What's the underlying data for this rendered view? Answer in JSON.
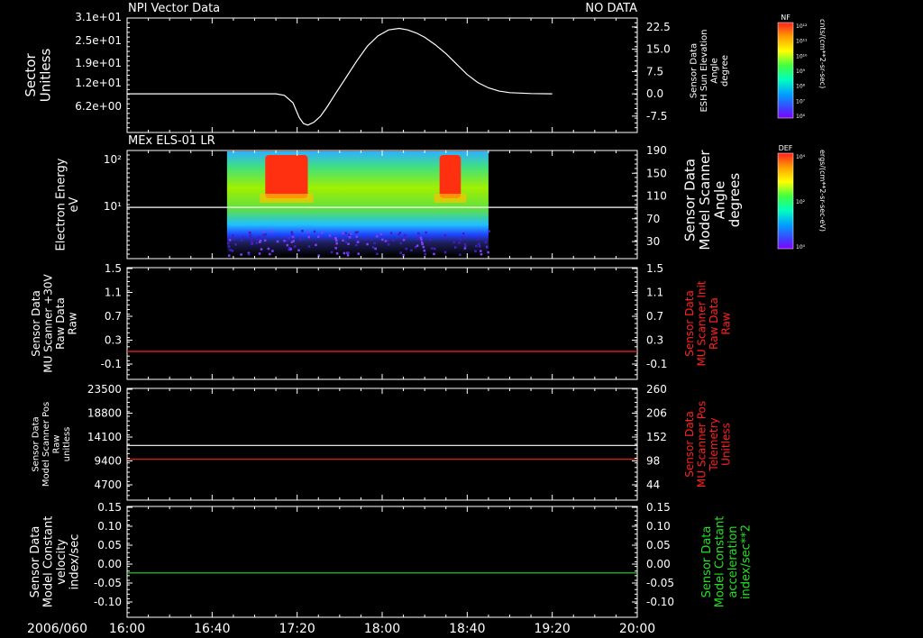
{
  "colors": {
    "white": "#ffffff",
    "red": "#ff2020",
    "green": "#20e020",
    "background": "#000000"
  },
  "time_axis": {
    "date_label": "2006/060",
    "ticks": [
      "16:00",
      "16:40",
      "17:20",
      "18:00",
      "18:40",
      "19:20",
      "20:00"
    ]
  },
  "colorbars": [
    {
      "label": "NF",
      "unit": "cnts/(cm**2-sr-sec)",
      "ticks": [
        "10¹²",
        "10¹¹",
        "10¹⁰",
        "10⁹",
        "10⁸",
        "10⁷",
        "10⁶"
      ]
    },
    {
      "label": "DEF",
      "unit": "ergs/(cm**2-sr-sec-eV)",
      "ticks": [
        "10⁴",
        "10²",
        "10⁰"
      ]
    }
  ],
  "chart_data": [
    {
      "type": "line",
      "panel": 1,
      "title": "NPI Vector Data",
      "status": "NO DATA",
      "ylabel_left": [
        "Sector",
        "Unitless"
      ],
      "yticks_left": [
        "3.1e+01",
        "2.5e+01",
        "1.9e+01",
        "1.2e+01",
        "6.2e+00"
      ],
      "ylabel_right": [
        "Sensor Data",
        "ESH Sun Elevation",
        "Angle",
        "degree"
      ],
      "yticks_right": [
        "22.5",
        "15.0",
        "7.5",
        "0.0",
        "-7.5"
      ],
      "ylim_right": [
        -13.0,
        25.5
      ],
      "series": [
        {
          "color": "white",
          "x": [
            "16:00",
            "17:10",
            "17:14",
            "17:18",
            "17:21",
            "17:23",
            "17:25",
            "17:28",
            "17:31",
            "17:34",
            "17:38",
            "17:43",
            "17:48",
            "17:53",
            "17:58",
            "18:03",
            "18:08",
            "18:12",
            "18:16",
            "18:20",
            "18:25",
            "18:30",
            "18:35",
            "18:40",
            "18:45",
            "18:50",
            "18:55",
            "19:00",
            "19:10",
            "19:20"
          ],
          "y": [
            0.0,
            0.0,
            -0.5,
            -3.0,
            -8.0,
            -10.0,
            -10.5,
            -9.5,
            -7.5,
            -4.5,
            0.0,
            5.5,
            11.0,
            16.0,
            19.5,
            21.5,
            22.0,
            21.5,
            20.5,
            19.0,
            16.5,
            13.5,
            10.0,
            6.5,
            3.8,
            2.0,
            0.9,
            0.4,
            0.1,
            0.0
          ]
        }
      ]
    },
    {
      "type": "heatmap",
      "panel": 2,
      "title": "MEx ELS-01 LR",
      "ylabel_left": [
        "Electron Energy",
        "eV"
      ],
      "yticks_left": [
        "10²",
        "10¹"
      ],
      "ylabel_right": [
        "Sensor Data",
        "Model Scanner",
        "Angle",
        "degrees"
      ],
      "yticks_right": [
        "190",
        "150",
        "110",
        "70",
        "30"
      ],
      "ylim_right": [
        0,
        190
      ],
      "data_span": [
        "16:47",
        "18:50"
      ],
      "intense_regions": [
        [
          "17:05",
          "17:25"
        ],
        [
          "18:27",
          "18:37"
        ]
      ],
      "series": [
        {
          "color": "white",
          "x": [
            "16:00",
            "20:00"
          ],
          "y": [
            90,
            90
          ]
        }
      ]
    },
    {
      "type": "line",
      "panel": 3,
      "ylabel_left": [
        "Sensor Data",
        "MU Scanner +30V",
        "Raw Data",
        "Raw"
      ],
      "yticks_left": [
        "1.5",
        "1.1",
        "0.7",
        "0.3",
        "-0.1"
      ],
      "ylabel_right": [
        "Sensor Data",
        "MU Scanner Init",
        "Raw Data",
        "Raw"
      ],
      "ylabel_right_color": "red",
      "yticks_right": [
        "1.5",
        "1.1",
        "0.7",
        "0.3",
        "-0.1"
      ],
      "ylim": [
        -0.5,
        1.5
      ],
      "series": [
        {
          "color": "red",
          "x": [
            "16:00",
            "20:00"
          ],
          "y": [
            0.0,
            0.0
          ]
        }
      ]
    },
    {
      "type": "line",
      "panel": 4,
      "ylabel_left": [
        "Sensor Data",
        "Model Scanner Pos",
        "Raw",
        "unitless"
      ],
      "yticks_left": [
        "23500",
        "18800",
        "14100",
        "9400",
        "4700"
      ],
      "ylabel_right": [
        "Sensor Data",
        "MU Scanner Pos",
        "Telemetry",
        "Unitless"
      ],
      "ylabel_right_color": "red",
      "yticks_right": [
        "260",
        "206",
        "152",
        "98",
        "44"
      ],
      "ylim_left": [
        0,
        23500
      ],
      "ylim_right": [
        0,
        260
      ],
      "series": [
        {
          "color": "white",
          "axis": "left",
          "x": [
            "16:00",
            "20:00"
          ],
          "y": [
            11500,
            11500
          ]
        },
        {
          "color": "red",
          "axis": "right",
          "x": [
            "16:00",
            "20:00"
          ],
          "y": [
            95,
            95
          ]
        }
      ]
    },
    {
      "type": "line",
      "panel": 5,
      "ylabel_left": [
        "Sensor Data",
        "Model Constant",
        "velocity",
        "index/sec"
      ],
      "yticks_left": [
        "0.15",
        "0.10",
        "0.05",
        "0.00",
        "-0.05",
        "-0.10"
      ],
      "ylabel_right": [
        "Sensor Data",
        "Model Constant",
        "acceleration",
        "index/sec**2"
      ],
      "ylabel_right_color": "green",
      "yticks_right": [
        "0.15",
        "0.10",
        "0.05",
        "0.00",
        "-0.05",
        "-0.10"
      ],
      "ylim": [
        -0.1,
        0.15
      ],
      "series": [
        {
          "color": "green",
          "x": [
            "16:00",
            "20:00"
          ],
          "y": [
            0.0,
            0.0
          ]
        }
      ]
    }
  ]
}
